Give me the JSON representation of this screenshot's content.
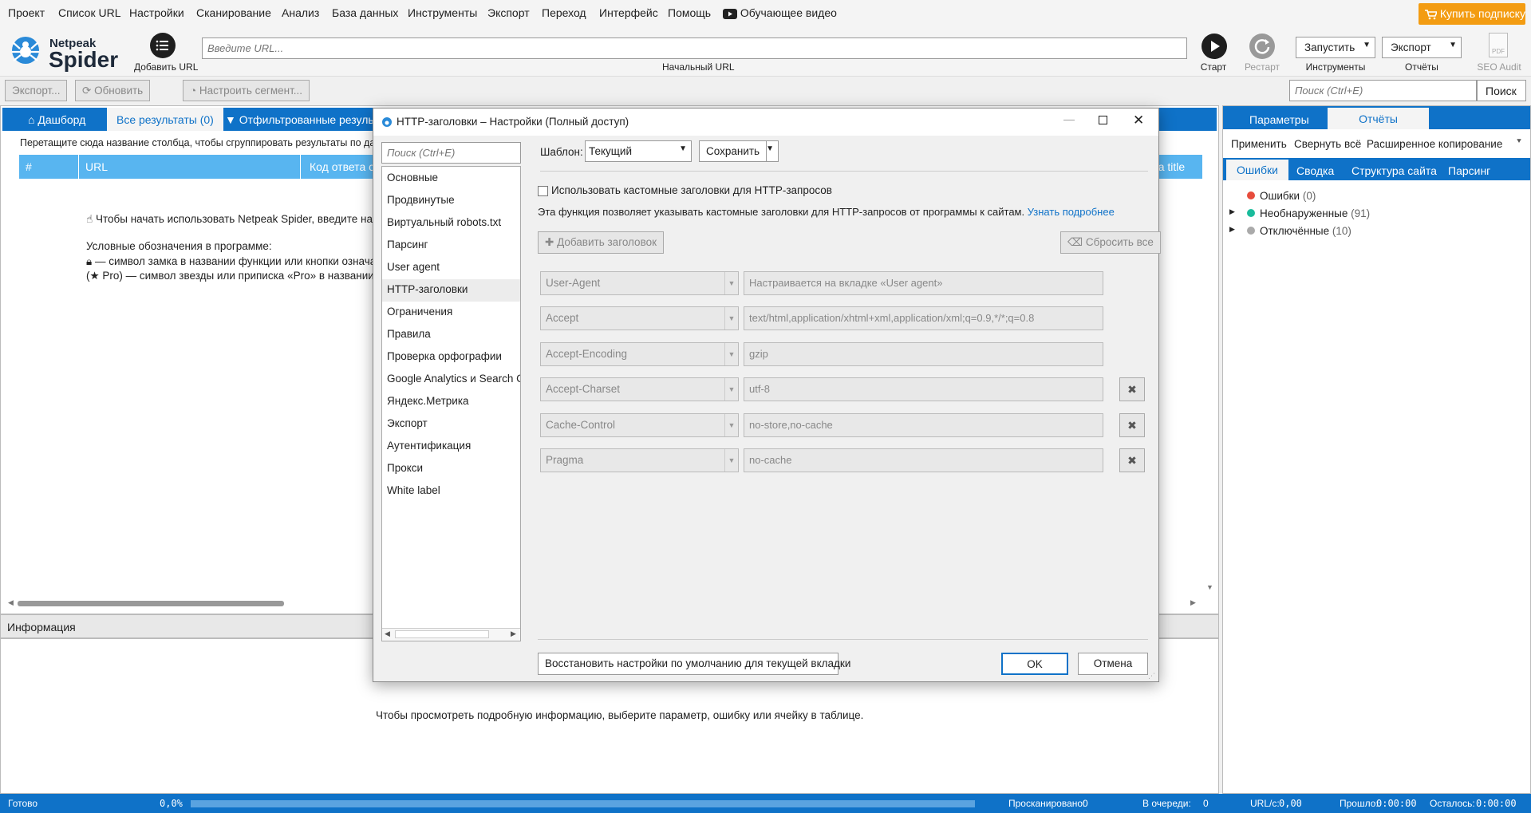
{
  "menu": [
    "Проект",
    "Список URL",
    "Настройки",
    "Сканирование",
    "Анализ",
    "База данных",
    "Инструменты",
    "Экспорт",
    "Переход",
    "Интерфейс",
    "Помощь",
    "Обучающее видео"
  ],
  "buy_label": "Купить подписку",
  "logo": {
    "line1": "Netpeak",
    "line2": "Spider"
  },
  "toolbar": {
    "add_url": "Добавить URL",
    "url_placeholder": "Введите URL...",
    "url_caption": "Начальный URL",
    "start": "Старт",
    "restart": "Рестарт",
    "run": "Запустить",
    "export": "Экспорт",
    "tools": "Инструменты",
    "reports": "Отчёты",
    "seo_audit": "SEO Audit",
    "pdf": "PDF"
  },
  "row2": {
    "export_btn": "Экспорт...",
    "refresh_btn": "Обновить",
    "segment_btn": "Настроить сегмент...",
    "search_placeholder": "Поиск (Ctrl+E)",
    "search_btn": "Поиск"
  },
  "left_tabs": {
    "dashboard": "Дашборд",
    "all_results": "Все результаты (0)",
    "filtered": "Отфильтрованные результат"
  },
  "group_hint": "Перетащите сюда название столбца, чтобы сгруппировать результаты по данно",
  "columns": {
    "num": "#",
    "url": "URL",
    "code": "Код ответа се",
    "title": "на title"
  },
  "hint": {
    "line1": "Чтобы начать использовать Netpeak Spider, введите нача",
    "legend_title": "Условные обозначения в программе:",
    "legend_lock": "— символ замка в названии функции или кнопки означа",
    "legend_star": "(★ Pro) — символ звезды или приписка «Pro» в названии фу"
  },
  "info": {
    "title": "Информация",
    "body": "Чтобы просмотреть подробную информацию, выберите параметр, ошибку или ячейку в таблице."
  },
  "status": {
    "ready": "Готово",
    "progress": "0,0%",
    "progress_fraction": 0.0,
    "scanned_label": "Просканировано:",
    "scanned": "0",
    "queue_label": "В очереди:",
    "queue": "0",
    "urls_label": "URL/с:",
    "urls": "0,00",
    "elapsed_label": "Прошло:",
    "elapsed": "0:00:00",
    "left_label": "Осталось:",
    "left": "0:00:00"
  },
  "right": {
    "tab_params": "Параметры",
    "tab_reports": "Отчёты",
    "apply": "Применить",
    "collapse": "Свернуть всё",
    "adv_copy": "Расширенное копирование",
    "subtabs": [
      "Ошибки",
      "Сводка",
      "Структура сайта",
      "Парсинг"
    ],
    "tree": [
      {
        "label": "Ошибки",
        "count": "(0)",
        "color": "#e74c3c",
        "expand": false
      },
      {
        "label": "Необнаруженные",
        "count": "(91)",
        "color": "#1abc9c",
        "expand": true
      },
      {
        "label": "Отключённые",
        "count": "(10)",
        "color": "#aaaaaa",
        "expand": true
      }
    ]
  },
  "dialog": {
    "title": "HTTP-заголовки – Настройки (Полный доступ)",
    "search_placeholder": "Поиск (Ctrl+E)",
    "items": [
      "Основные",
      "Продвинутые",
      "Виртуальный robots.txt",
      "Парсинг",
      "User agent",
      "HTTP-заголовки",
      "Ограничения",
      "Правила",
      "Проверка орфографии",
      "Google Analytics и Search Co",
      "Яндекс.Метрика",
      "Экспорт",
      "Аутентификация",
      "Прокси",
      "White label"
    ],
    "selected_index": 5,
    "template_label": "Шаблон:",
    "template_value": "Текущий",
    "save_btn": "Сохранить",
    "custom_headers_checkbox": "Использовать кастомные заголовки для HTTP-запросов",
    "description": "Эта функция позволяет указывать кастомные заголовки для HTTP-запросов от программы к сайтам.",
    "learn_more": "Узнать подробнее",
    "add_header": "Добавить заголовок",
    "reset_all": "Сбросить все",
    "headers": [
      {
        "name": "User-Agent",
        "value": "Настраивается на вкладке «User agent»",
        "removable": false
      },
      {
        "name": "Accept",
        "value": "text/html,application/xhtml+xml,application/xml;q=0.9,*/*;q=0.8",
        "removable": false
      },
      {
        "name": "Accept-Encoding",
        "value": "gzip",
        "removable": false
      },
      {
        "name": "Accept-Charset",
        "value": "utf-8",
        "removable": true
      },
      {
        "name": "Cache-Control",
        "value": "no-store,no-cache",
        "removable": true
      },
      {
        "name": "Pragma",
        "value": "no-cache",
        "removable": true
      }
    ],
    "restore_btn": "Восстановить настройки по умолчанию для текущей вкладки",
    "ok": "OK",
    "cancel": "Отмена"
  },
  "colors": {
    "accent": "#0f72c8",
    "table_head": "#58b5f0",
    "buy": "#f39c12",
    "link": "#0f72c8"
  }
}
